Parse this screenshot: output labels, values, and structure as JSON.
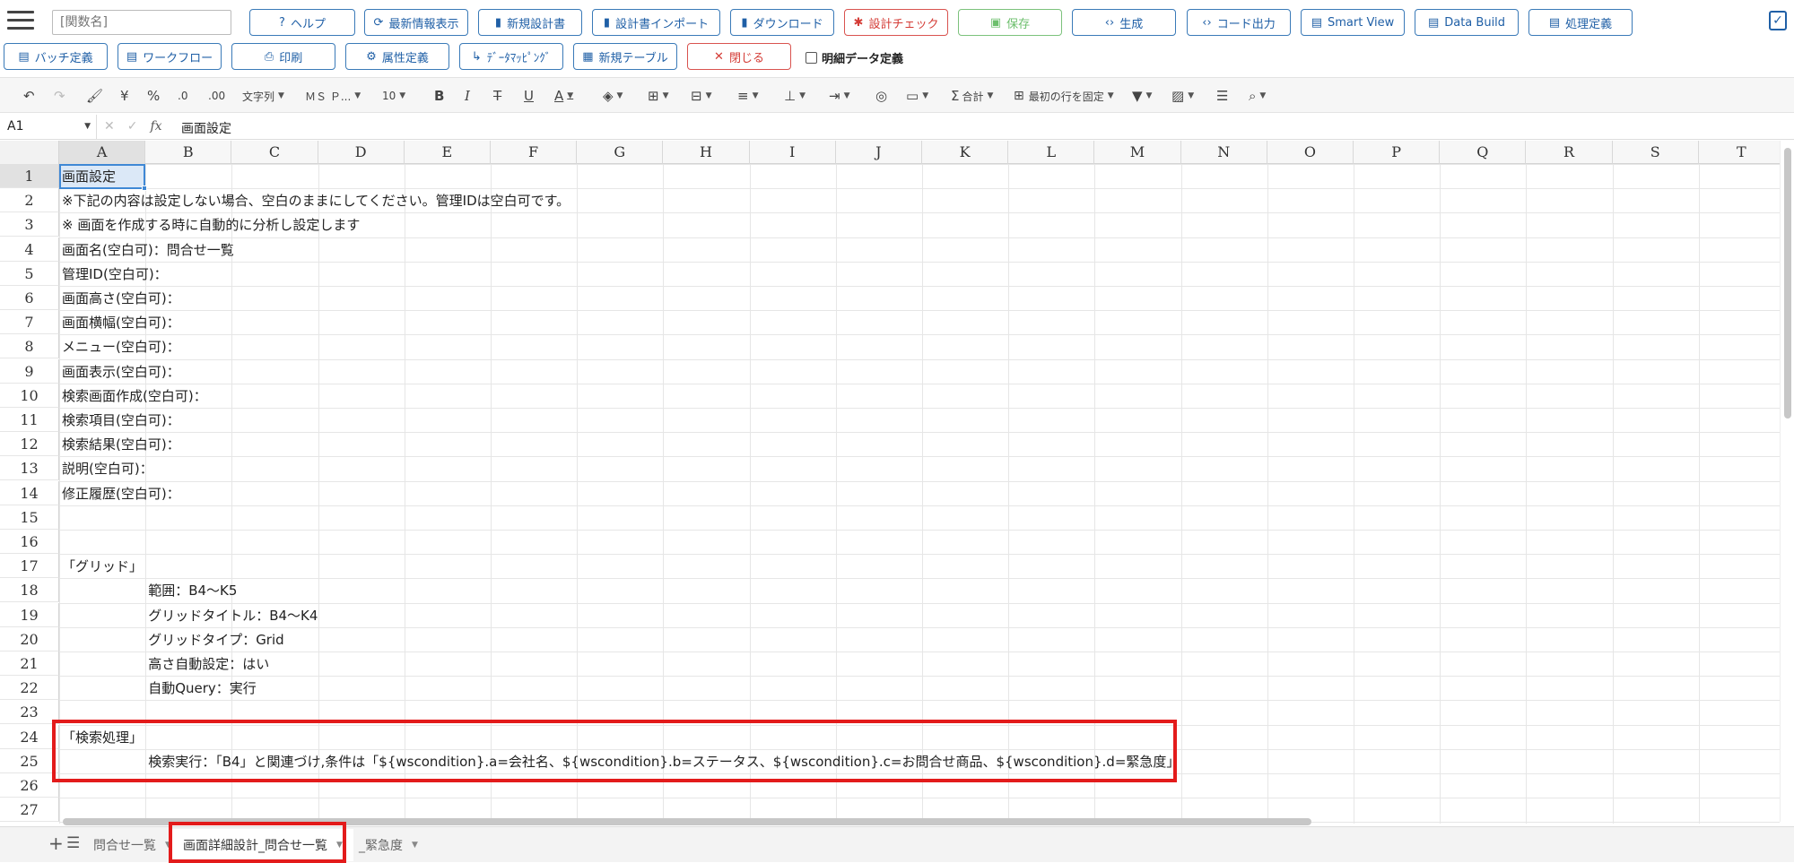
{
  "topbar": {
    "function_name_placeholder": "[関数名]",
    "row1_buttons": [
      {
        "label": "ヘルプ",
        "icon": "?"
      },
      {
        "label": "最新情報表示",
        "icon": "⟳"
      },
      {
        "label": "新規設計書",
        "icon": "▮"
      },
      {
        "label": "設計書インポート",
        "icon": "▮"
      },
      {
        "label": "ダウンロード",
        "icon": "▮"
      },
      {
        "label": "設計チェック",
        "icon": "✱"
      },
      {
        "label": "保存",
        "icon": "▣"
      },
      {
        "label": "生成",
        "icon": "‹›"
      },
      {
        "label": "コード出力",
        "icon": "‹›"
      },
      {
        "label": "Smart View",
        "icon": "▤"
      },
      {
        "label": "Data Build",
        "icon": "▤"
      },
      {
        "label": "処理定義",
        "icon": "▤"
      }
    ],
    "row2_buttons": [
      {
        "label": "バッチ定義",
        "icon": "▤"
      },
      {
        "label": "ワークフロー",
        "icon": "▤"
      },
      {
        "label": "印刷",
        "icon": "⎙"
      },
      {
        "label": "属性定義",
        "icon": "⚙"
      },
      {
        "label": "ﾃﾞｰﾀﾏｯﾋﾟﾝｸﾞ",
        "icon": "↳"
      },
      {
        "label": "新規テーブル",
        "icon": "▦"
      },
      {
        "label": "閉じる",
        "icon": "✕"
      }
    ],
    "detail_checkbox_label": "明細データ定義"
  },
  "toolbar": {
    "text_type": "文字列",
    "font_name": "ＭＳ Ｐ...",
    "font_size": "10",
    "sum_label": "合計",
    "freeze_label": "最初の行を固定"
  },
  "formula_bar": {
    "cell_ref": "A1",
    "fx": "fx",
    "value": "画面設定"
  },
  "columns": [
    "A",
    "B",
    "C",
    "D",
    "E",
    "F",
    "G",
    "H",
    "I",
    "J",
    "K",
    "L",
    "M",
    "N",
    "O",
    "P",
    "Q",
    "R",
    "S",
    "T"
  ],
  "rows": [
    "1",
    "2",
    "3",
    "4",
    "5",
    "6",
    "7",
    "8",
    "9",
    "10",
    "11",
    "12",
    "13",
    "14",
    "15",
    "16",
    "17",
    "18",
    "19",
    "20",
    "21",
    "22",
    "23",
    "24",
    "25",
    "26",
    "27"
  ],
  "cells": {
    "r1": "画面設定",
    "r2": "※下記の内容は設定しない場合、空白のままにしてください。管理IDは空白可です。",
    "r3": "※ 画面を作成する時に自動的に分析し設定します",
    "r4": "画面名(空白可)：問合せ一覧",
    "r5": "管理ID(空白可)：",
    "r6": "画面高さ(空白可)：",
    "r7": "画面横幅(空白可)：",
    "r8": "メニュー(空白可)：",
    "r9": "画面表示(空白可)：",
    "r10": "検索画面作成(空白可)：",
    "r11": "検索項目(空白可)：",
    "r12": "検索結果(空白可)：",
    "r13": "説明(空白可)：",
    "r14": "修正履歴(空白可)：",
    "r17": "「グリッド」",
    "r18": "範囲：B4～K5",
    "r19": "グリッドタイトル：B4～K4",
    "r20": "グリッドタイプ：Grid",
    "r21": "高さ自動設定：はい",
    "r22": "自動Query：実行",
    "r24": "「検索処理」",
    "r25": "検索実行：「B4」と関連づけ,条件は「${wscondition}.a=会社名、${wscondition}.b=ステータス、${wscondition}.c=お問合せ商品、${wscondition}.d=緊急度」"
  },
  "sheet_tabs": [
    {
      "label": "問合せ一覧",
      "active": false
    },
    {
      "label": "画面詳細設計_問合せ一覧",
      "active": true
    },
    {
      "label": "_緊急度",
      "active": false
    }
  ],
  "colors": {
    "accent": "#1f5fa6",
    "danger": "#d43c36",
    "save_disabled": "#6cbf6c",
    "highlight_box": "#e31b1b",
    "selection": "#3f88d5"
  }
}
